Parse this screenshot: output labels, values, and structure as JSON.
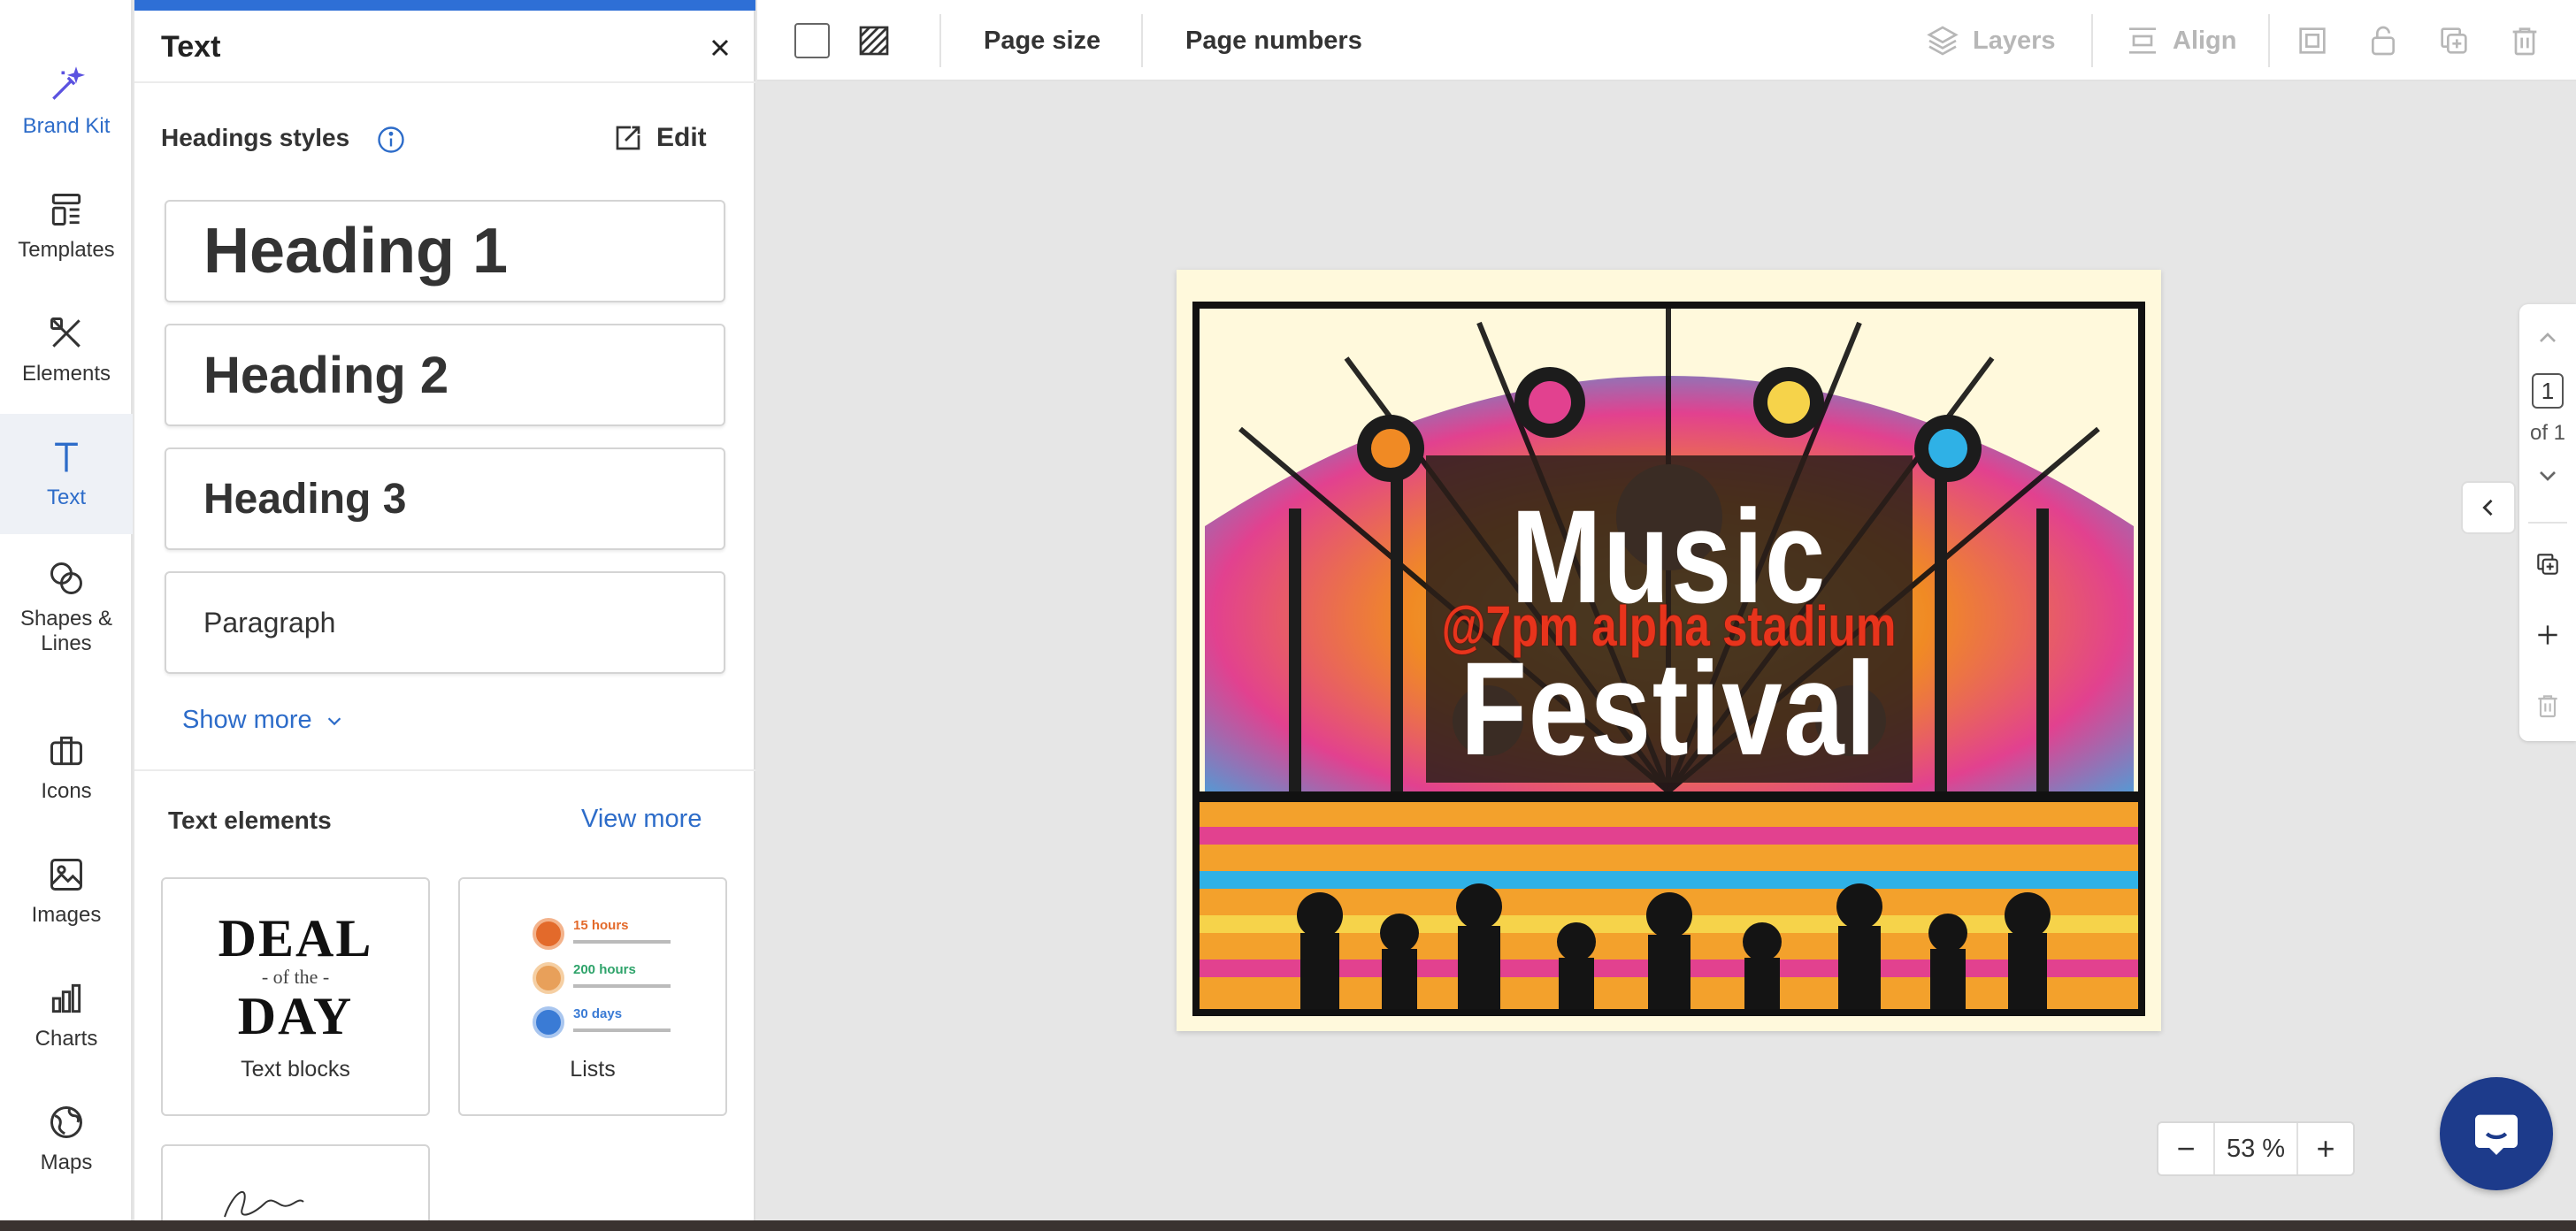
{
  "rail": {
    "items": [
      {
        "label": "Brand Kit",
        "icon": "magic-wand-icon"
      },
      {
        "label": "Templates",
        "icon": "templates-icon"
      },
      {
        "label": "Elements",
        "icon": "elements-icon"
      },
      {
        "label": "Text",
        "icon": "text-icon"
      },
      {
        "label": "Shapes &\nLines",
        "icon": "shapes-icon"
      },
      {
        "label": "Icons",
        "icon": "briefcase-icon"
      },
      {
        "label": "Images",
        "icon": "image-icon"
      },
      {
        "label": "Charts",
        "icon": "bar-chart-icon"
      },
      {
        "label": "Maps",
        "icon": "globe-icon"
      }
    ],
    "active": "Text"
  },
  "panel": {
    "title": "Text",
    "headings_title": "Headings styles",
    "edit_label": "Edit",
    "styles": [
      "Heading 1",
      "Heading 2",
      "Heading 3",
      "Paragraph"
    ],
    "show_more": "Show more",
    "text_elements_title": "Text elements",
    "view_more": "View more",
    "cards": [
      {
        "label": "Text blocks",
        "deal_top": "DEAL",
        "deal_mid": "- of the -",
        "deal_bottom": "DAY"
      },
      {
        "label": "Lists",
        "rows": [
          "15 hours",
          "200 hours",
          "30 days"
        ]
      }
    ]
  },
  "toolbar": {
    "page_size": "Page size",
    "page_numbers": "Page numbers",
    "layers": "Layers",
    "align": "Align"
  },
  "poster": {
    "title_1": "Music",
    "subtitle": "@7pm alpha stadium",
    "title_2": "Festival"
  },
  "pager": {
    "current": "1",
    "of_label": "of 1"
  },
  "zoom": {
    "value": "53 %",
    "minus": "−",
    "plus": "+"
  },
  "colors": {
    "accent": "#2e6fd6",
    "chat": "#1d3b8b",
    "list1": "#e36a2b",
    "list2": "#2ea36a",
    "list3": "#3a7bd5"
  }
}
